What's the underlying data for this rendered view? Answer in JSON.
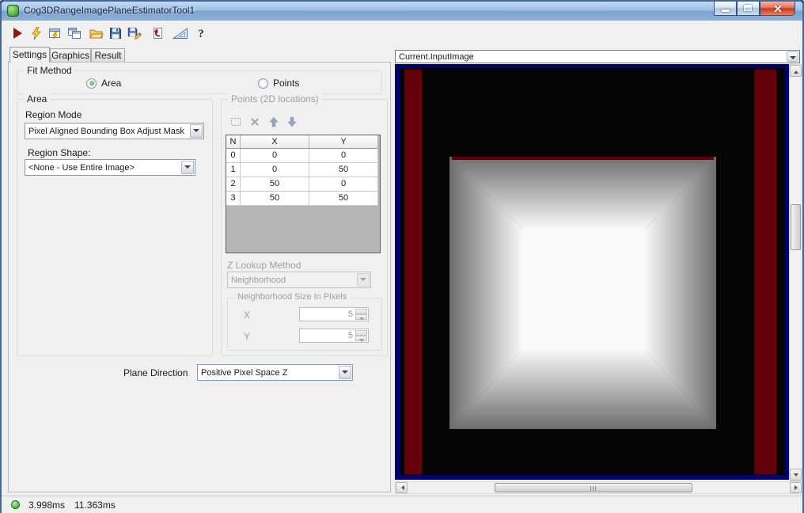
{
  "window": {
    "title": "Cog3DRangeImagePlaneEstimatorTool1"
  },
  "toolbar": {
    "icons": [
      "run",
      "run-continuous",
      "run-window",
      "copy-results",
      "open-file",
      "save",
      "save-as",
      "revert",
      "measure-tool",
      "help"
    ]
  },
  "tabs": {
    "settings": "Settings",
    "graphics": "Graphics",
    "result": "Result"
  },
  "fit_method": {
    "label": "Fit Method",
    "area_label": "Area",
    "points_label": "Points",
    "selected": "Area"
  },
  "area_group": {
    "label": "Area",
    "region_mode_label": "Region Mode",
    "region_mode_value": "Pixel Aligned Bounding Box Adjust Mask",
    "region_shape_label": "Region Shape:",
    "region_shape_value": "<None - Use Entire Image>"
  },
  "points_group": {
    "label": "Points (2D locations)",
    "grid": {
      "col_n": "N",
      "col_x": "X",
      "col_y": "Y",
      "rows": [
        {
          "n": "0",
          "x": "0",
          "y": "0"
        },
        {
          "n": "1",
          "x": "0",
          "y": "50"
        },
        {
          "n": "2",
          "x": "50",
          "y": "0"
        },
        {
          "n": "3",
          "x": "50",
          "y": "50"
        }
      ]
    },
    "z_lookup_label": "Z Lookup Method",
    "z_lookup_value": "Neighborhood",
    "neighborhood_label": "Neighborhood Size In Pixels",
    "x_label": "X",
    "x_value": "5",
    "y_label": "Y",
    "y_value": "5"
  },
  "plane_direction": {
    "label": "Plane Direction",
    "value": "Positive Pixel Space Z"
  },
  "image_panel": {
    "source": "Current.InputImage"
  },
  "status": {
    "time_1": "3.998ms",
    "time_2": "11.363ms"
  },
  "colors": {
    "image_border_blue": "#00006f",
    "stripe_red": "#630009",
    "status_green": "#1f9e1f",
    "titlebar_blue": "#9dbfe4"
  }
}
